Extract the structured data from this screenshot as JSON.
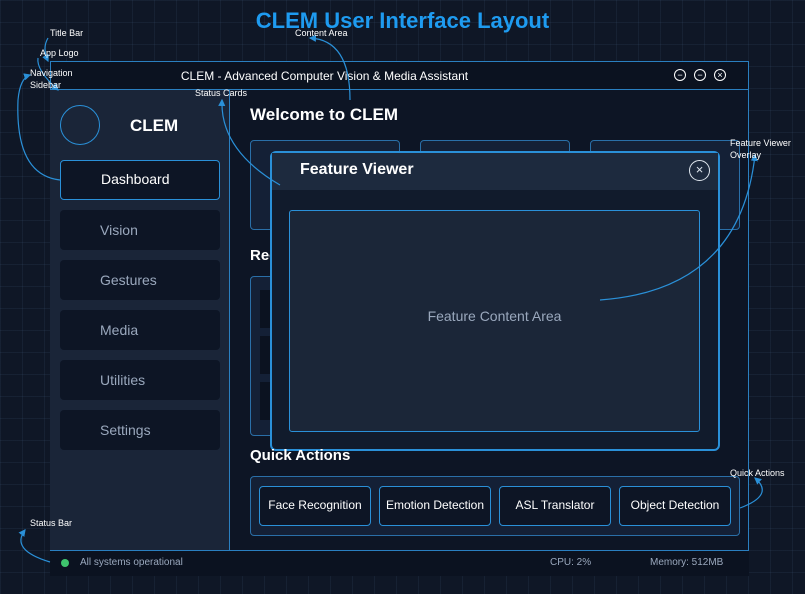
{
  "diagram_title": "CLEM User Interface Layout",
  "window": {
    "title": "CLEM - Advanced Computer Vision & Media Assistant",
    "controls": [
      "minimize-icon",
      "maximize-icon",
      "close-icon"
    ]
  },
  "sidebar": {
    "logo_text": "CLEM",
    "items": [
      {
        "label": "Dashboard",
        "active": true
      },
      {
        "label": "Vision"
      },
      {
        "label": "Gestures"
      },
      {
        "label": "Media"
      },
      {
        "label": "Utilities"
      },
      {
        "label": "Settings"
      }
    ]
  },
  "main": {
    "welcome": "Welcome to CLEM",
    "recent_title": "Rece",
    "quick_actions_title": "Quick Actions",
    "quick_actions": [
      "Face Recognition",
      "Emotion Detection",
      "ASL Translator",
      "Object Detection"
    ]
  },
  "overlay": {
    "title": "Feature Viewer",
    "content": "Feature Content Area"
  },
  "status_bar": {
    "status": "All systems operational",
    "cpu": "CPU: 2%",
    "memory": "Memory: 512MB"
  },
  "annotations": {
    "title_bar": "Title Bar",
    "content_area": "Content Area",
    "app_logo": "App Logo",
    "navigation_sidebar": [
      "Navigation",
      "Sidebar"
    ],
    "status_cards": "Status Cards",
    "feature_viewer_overlay": [
      "Feature Viewer",
      "Overlay"
    ],
    "quick_actions": "Quick Actions",
    "status_bar": "Status Bar"
  },
  "colors": {
    "accent": "#2a90d8",
    "title": "#1e9bf0",
    "status_ok": "#3ec46d"
  }
}
